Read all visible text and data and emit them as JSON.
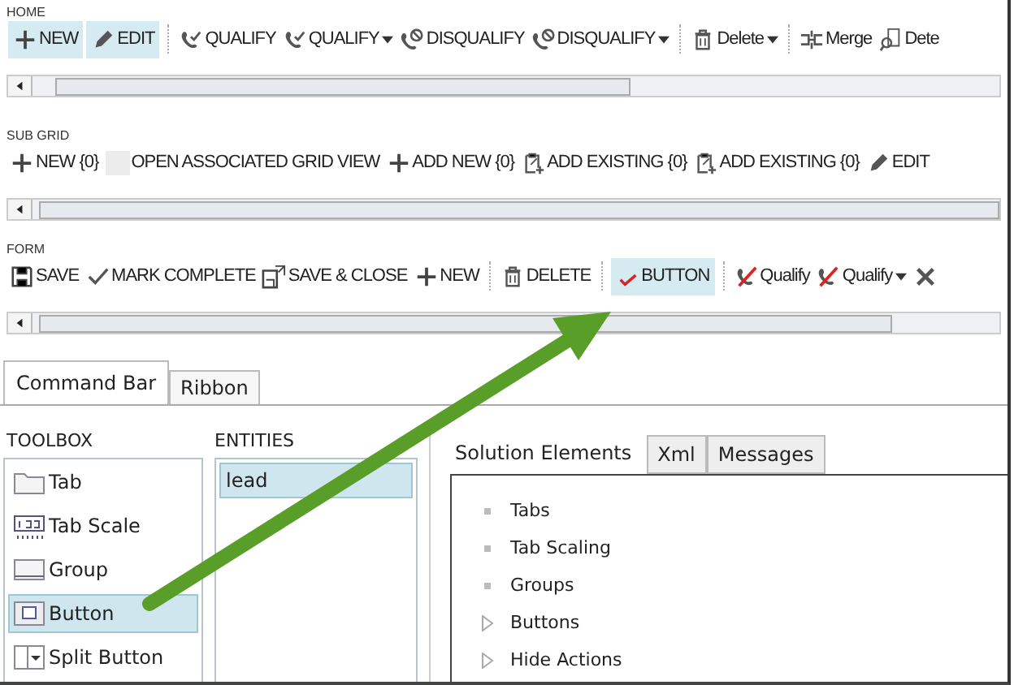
{
  "sections": [
    {
      "label": "HOME",
      "groups": [
        {
          "items": [
            {
              "label": "NEW",
              "dropdown": false,
              "selected": true
            },
            {
              "label": "EDIT",
              "dropdown": false,
              "selected": true
            }
          ]
        },
        {
          "items": [
            {
              "label": "QUALIFY",
              "dropdown": false,
              "selected": false
            },
            {
              "label": "QUALIFY",
              "dropdown": true,
              "selected": false
            },
            {
              "label": "DISQUALIFY",
              "dropdown": false,
              "selected": false
            },
            {
              "label": "DISQUALIFY",
              "dropdown": true,
              "selected": false
            }
          ]
        },
        {
          "items": [
            {
              "label": "Delete",
              "dropdown": true,
              "selected": false
            }
          ]
        },
        {
          "items": [
            {
              "label": "Merge",
              "dropdown": false,
              "selected": false
            },
            {
              "label": "Dete",
              "dropdown": false,
              "selected": false
            }
          ]
        }
      ]
    },
    {
      "label": "SUB GRID",
      "groups": [
        {
          "items": [
            {
              "label": "NEW {0}",
              "dropdown": false,
              "selected": false
            },
            {
              "label": "OPEN ASSOCIATED GRID VIEW",
              "dropdown": false,
              "selected": false
            },
            {
              "label": "ADD NEW {0}",
              "dropdown": false,
              "selected": false
            },
            {
              "label": "ADD EXISTING {0}",
              "dropdown": false,
              "selected": false
            },
            {
              "label": "ADD EXISTING {0}",
              "dropdown": false,
              "selected": false
            },
            {
              "label": "EDIT",
              "dropdown": false,
              "selected": false
            }
          ]
        }
      ]
    },
    {
      "label": "FORM",
      "groups": [
        {
          "items": [
            {
              "label": "SAVE",
              "dropdown": false,
              "selected": false
            },
            {
              "label": "MARK COMPLETE",
              "dropdown": false,
              "selected": false
            },
            {
              "label": "SAVE & CLOSE",
              "dropdown": false,
              "selected": false
            },
            {
              "label": "NEW",
              "dropdown": false,
              "selected": false
            }
          ]
        },
        {
          "items": [
            {
              "label": "DELETE",
              "dropdown": false,
              "selected": false
            }
          ]
        },
        {
          "items": [
            {
              "label": "BUTTON",
              "dropdown": false,
              "selected": true
            }
          ]
        },
        {
          "items": [
            {
              "label": "Qualify",
              "dropdown": false,
              "selected": false
            },
            {
              "label": "Qualify",
              "dropdown": true,
              "selected": false
            },
            {
              "dropdown": false,
              "selected": false
            }
          ]
        }
      ]
    }
  ],
  "view_tabs": [
    {
      "label": "Command Bar",
      "selected": true
    },
    {
      "label": "Ribbon",
      "selected": false
    }
  ],
  "toolbox": {
    "title": "TOOLBOX",
    "items": [
      {
        "label": "Tab",
        "selected": false
      },
      {
        "label": "Tab Scale",
        "selected": false
      },
      {
        "label": "Group",
        "selected": false
      },
      {
        "label": "Button",
        "selected": true
      },
      {
        "label": "Split Button",
        "selected": false
      }
    ]
  },
  "entities": {
    "title": "ENTITIES",
    "items": [
      {
        "label": "lead",
        "selected": true
      }
    ]
  },
  "solution": {
    "tabs": [
      {
        "label": "Solution Elements",
        "selected": true
      },
      {
        "label": "Xml",
        "selected": false
      },
      {
        "label": "Messages",
        "selected": false
      }
    ],
    "tree": [
      {
        "label": "Tabs",
        "kind": "leaf"
      },
      {
        "label": "Tab Scaling",
        "kind": "leaf"
      },
      {
        "label": "Groups",
        "kind": "leaf"
      },
      {
        "label": "Buttons",
        "kind": "branch",
        "expanded": false
      },
      {
        "label": "Hide Actions",
        "kind": "branch",
        "expanded": false
      }
    ]
  }
}
